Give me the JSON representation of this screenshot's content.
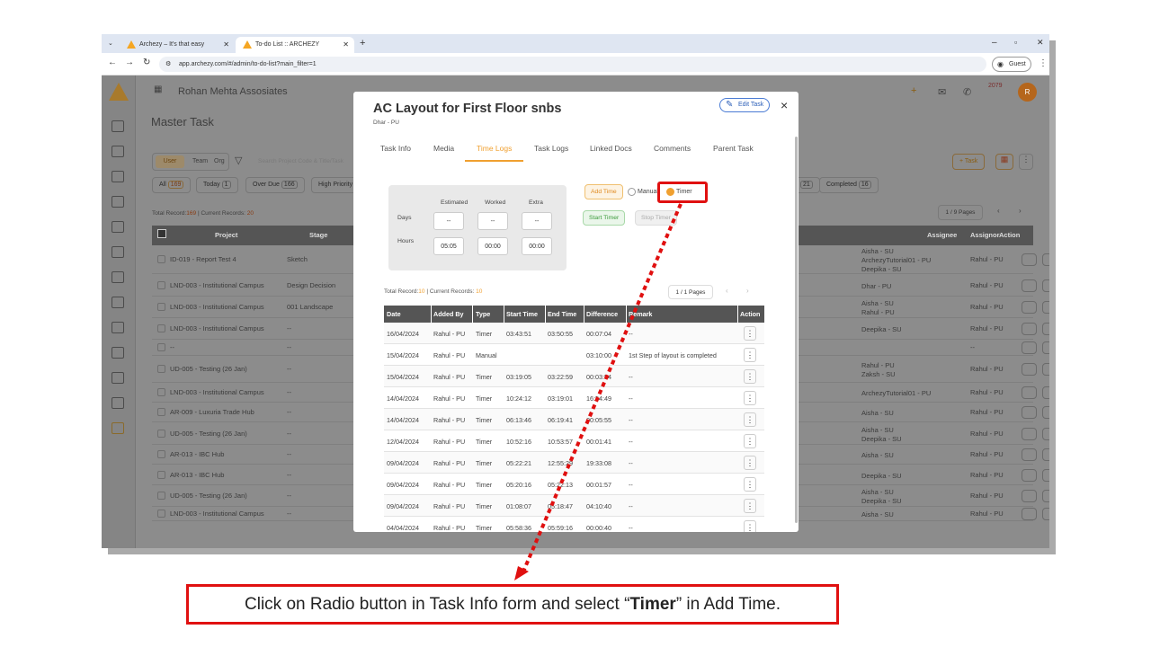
{
  "browser": {
    "tabs": [
      {
        "label": "Archezy – It's that easy",
        "active": false
      },
      {
        "label": "To-do List :: ARCHEZY",
        "active": true
      }
    ],
    "url": "app.archezy.com/#/admin/to-do-list?main_filter=1",
    "profile": "Guest"
  },
  "app": {
    "company": "Rohan Mehta Assosiates",
    "page_title": "Master Task",
    "notif_count": "2079",
    "avatar_letter": "R",
    "scope_tabs": [
      "User",
      "Team",
      "Org"
    ],
    "search_placeholder": "Search Project Code & Title/Task",
    "filters": [
      {
        "label": "All",
        "count": "169"
      },
      {
        "label": "Today",
        "count": "1"
      },
      {
        "label": "Over Due",
        "count": "166"
      },
      {
        "label": "High Priority",
        "count": ""
      }
    ],
    "completed_filter": {
      "label": "Completed",
      "count": "16"
    },
    "extra_count": "21",
    "task_button": "+ Task",
    "record_info": {
      "prefix": "Total Record:",
      "total": "169",
      "mid": " | Current Records: ",
      "current": "20"
    },
    "pages": "1 / 9 Pages",
    "table_headers": [
      "Project",
      "Stage",
      "Assignee",
      "Assignor",
      "Action"
    ],
    "rows": [
      {
        "project": "ID-019 - Report Test 4",
        "stage": "Sketch",
        "assignee": [
          "Aisha - SU",
          "ArchezyTutorial01 - PU",
          "Deepika - SU"
        ],
        "assignor": "Rahul - PU"
      },
      {
        "project": "LND-003 - Institutional Campus",
        "stage": "Design Decision",
        "assignee": [
          "Dhar - PU"
        ],
        "assignor": "Rahul - PU"
      },
      {
        "project": "LND-003 - Institutional Campus",
        "stage": "001 Landscape",
        "assignee": [
          "Aisha - SU",
          "Rahul - PU"
        ],
        "assignor": "Rahul - PU"
      },
      {
        "project": "LND-003 - Institutional Campus",
        "stage": "--",
        "assignee": [
          "Deepika - SU"
        ],
        "assignor": "Rahul - PU"
      },
      {
        "project": "--",
        "stage": "--",
        "assignee": [],
        "assignor": "--"
      },
      {
        "project": "UD-005 - Testing (26 Jan)",
        "stage": "--",
        "assignee": [
          "Rahul - PU",
          "Zaksh - SU"
        ],
        "assignor": "Rahul - PU"
      },
      {
        "project": "LND-003 - Institutional Campus",
        "stage": "--",
        "assignee": [
          "ArchezyTutorial01 - PU"
        ],
        "assignor": "Rahul - PU"
      },
      {
        "project": "AR-009 - Luxuria Trade Hub",
        "stage": "--",
        "assignee": [
          "Aisha - SU"
        ],
        "assignor": "Rahul - PU"
      },
      {
        "project": "UD-005 - Testing (26 Jan)",
        "stage": "--",
        "assignee": [
          "Aisha - SU",
          "Deepika - SU"
        ],
        "assignor": "Rahul - PU"
      },
      {
        "project": "AR-013 - IBC Hub",
        "stage": "--",
        "assignee": [
          "Aisha - SU"
        ],
        "assignor": "Rahul - PU"
      },
      {
        "project": "AR-013 - IBC Hub",
        "stage": "--",
        "assignee": [
          "Deepika - SU"
        ],
        "assignor": "Rahul - PU"
      },
      {
        "project": "UD-005 - Testing (26 Jan)",
        "stage": "--",
        "assignee": [
          "Aisha - SU",
          "Deepika - SU"
        ],
        "assignor": "Rahul - PU"
      },
      {
        "project": "LND-003 - Institutional Campus",
        "stage": "--",
        "assignee": [
          "Aisha - SU"
        ],
        "assignor": "Rahul - PU"
      }
    ]
  },
  "modal": {
    "title": "AC Layout for First Floor snbs",
    "subtitle": "Dhar - PU",
    "edit_label": "Edit Task",
    "close": "×",
    "tabs": [
      "Task Info",
      "Media",
      "Time Logs",
      "Task Logs",
      "Linked Docs",
      "Comments",
      "Parent Task"
    ],
    "active_tab": "Time Logs",
    "time_cols": [
      "Estimated",
      "Worked",
      "Extra"
    ],
    "days_label": "Days",
    "hours_label": "Hours",
    "days": [
      "--",
      "--",
      "--"
    ],
    "hours": [
      "05:05",
      "00:00",
      "00:00"
    ],
    "add_time": "Add Time",
    "radio_manual": "Manual",
    "radio_timer": "Timer",
    "start_timer": "Start Timer",
    "stop_timer": "Stop Timer",
    "record_info": {
      "prefix": "Total Record:",
      "total": "10",
      "mid": " | Current Records: ",
      "current": "10"
    },
    "pages": "1 / 1 Pages",
    "log_headers": [
      "Date",
      "Added By",
      "Type",
      "Start Time",
      "End Time",
      "Difference",
      "Remark",
      "Action"
    ],
    "logs": [
      {
        "date": "16/04/2024",
        "by": "Rahul - PU",
        "type": "Timer",
        "start": "03:43:51",
        "end": "03:50:55",
        "diff": "00:07:04",
        "remark": "--"
      },
      {
        "date": "15/04/2024",
        "by": "Rahul - PU",
        "type": "Manual",
        "start": "",
        "end": "",
        "diff": "03:10:00",
        "remark": "1st Step of layout is completed"
      },
      {
        "date": "15/04/2024",
        "by": "Rahul - PU",
        "type": "Timer",
        "start": "03:19:05",
        "end": "03:22:59",
        "diff": "00:03:54",
        "remark": "--"
      },
      {
        "date": "14/04/2024",
        "by": "Rahul - PU",
        "type": "Timer",
        "start": "10:24:12",
        "end": "03:19:01",
        "diff": "16:54:49",
        "remark": "--"
      },
      {
        "date": "14/04/2024",
        "by": "Rahul - PU",
        "type": "Timer",
        "start": "06:13:46",
        "end": "06:19:41",
        "diff": "00:05:55",
        "remark": "--"
      },
      {
        "date": "12/04/2024",
        "by": "Rahul - PU",
        "type": "Timer",
        "start": "10:52:16",
        "end": "10:53:57",
        "diff": "00:01:41",
        "remark": "--"
      },
      {
        "date": "09/04/2024",
        "by": "Rahul - PU",
        "type": "Timer",
        "start": "05:22:21",
        "end": "12:55:29",
        "diff": "19:33:08",
        "remark": "--"
      },
      {
        "date": "09/04/2024",
        "by": "Rahul - PU",
        "type": "Timer",
        "start": "05:20:16",
        "end": "05:22:13",
        "diff": "00:01:57",
        "remark": "--"
      },
      {
        "date": "09/04/2024",
        "by": "Rahul - PU",
        "type": "Timer",
        "start": "01:08:07",
        "end": "05:18:47",
        "diff": "04:10:40",
        "remark": "--"
      },
      {
        "date": "04/04/2024",
        "by": "Rahul - PU",
        "type": "Timer",
        "start": "05:58:36",
        "end": "05:59:16",
        "diff": "00:00:40",
        "remark": "--"
      }
    ]
  },
  "instruction": {
    "before": "Click on Radio button in Task Info form and select “",
    "bold": "Timer",
    "after": "” in Add Time."
  },
  "colors": {
    "accent": "#f0a030",
    "highlight": "#e01010",
    "link": "#2c5fb8"
  }
}
